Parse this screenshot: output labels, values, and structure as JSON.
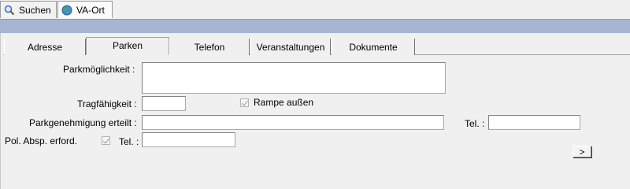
{
  "doc_tabs": [
    {
      "label": "Suchen",
      "icon": "magnifier-icon"
    },
    {
      "label": "VA-Ort",
      "icon": "globe-icon"
    }
  ],
  "sub_tabs": [
    "Adresse",
    "Parken",
    "Telefon",
    "Veranstaltungen",
    "Dokumente"
  ],
  "form": {
    "parkmoeglichkeit_label": "Parkmöglichkeit :",
    "parkmoeglichkeit_value": "",
    "tragfaehigkeit_label": "Tragfähigkeit :",
    "tragfaehigkeit_value": "",
    "rampe_label": "Rampe außen",
    "parkgenehmigung_label": "Parkgenehmigung erteilt :",
    "parkgenehmigung_value": "",
    "tel1_label": "Tel. :",
    "tel1_value": "",
    "pol_label": "Pol. Absp. erford.",
    "tel2_label": "Tel. :",
    "tel2_value": "",
    "next_button": ">"
  },
  "colors": {
    "band": "#a7b5d3",
    "panel": "#f0f0f0"
  }
}
